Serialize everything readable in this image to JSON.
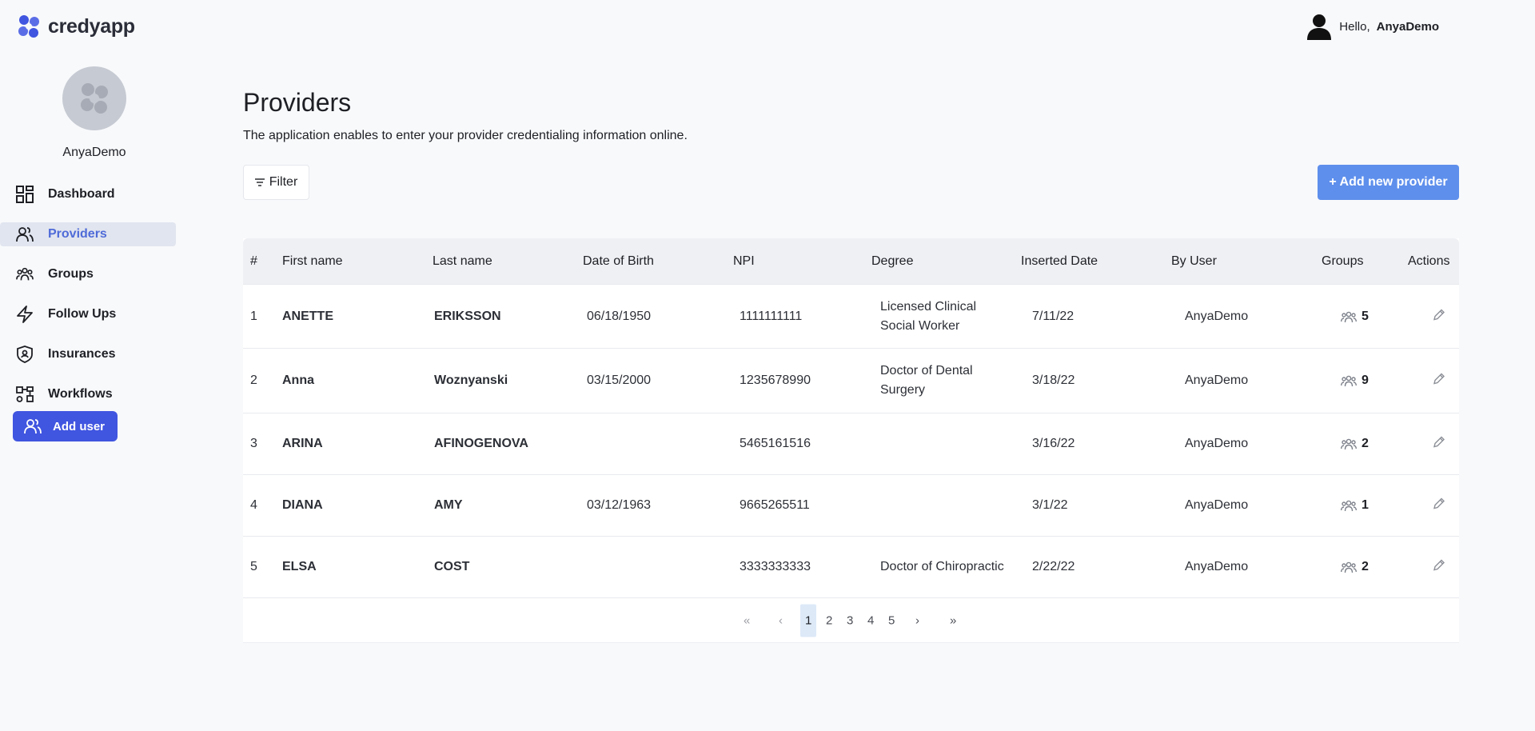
{
  "brand": {
    "name": "credyapp",
    "accent": "#4055e0"
  },
  "header": {
    "greeting": "Hello,",
    "user_name": "AnyaDemo",
    "user_icon": "user-silhouette-icon"
  },
  "sidebar": {
    "account_name": "AnyaDemo",
    "items": [
      {
        "label": "Dashboard",
        "icon": "dashboard-icon"
      },
      {
        "label": "Providers",
        "icon": "users-icon",
        "active": true
      },
      {
        "label": "Groups",
        "icon": "groups-icon"
      },
      {
        "label": "Follow Ups",
        "icon": "lightning-icon"
      },
      {
        "label": "Insurances",
        "icon": "shield-icon"
      },
      {
        "label": "Workflows",
        "icon": "workflow-icon"
      }
    ],
    "add_user_label": "Add user"
  },
  "main": {
    "title": "Providers",
    "subtitle": "The application enables to enter your provider credentialing information online.",
    "filter_label": "Filter",
    "add_provider_label": "+ Add new provider"
  },
  "table": {
    "columns": [
      "#",
      "First name",
      "Last name",
      "Date of Birth",
      "NPI",
      "Degree",
      "Inserted Date",
      "By User",
      "Groups",
      "Actions"
    ],
    "rows": [
      {
        "num": "1",
        "first": "ANETTE",
        "last": "ERIKSSON",
        "dob": "06/18/1950",
        "npi": "1111111111",
        "degree": "Licensed Clinical Social Worker",
        "inserted": "7/11/22",
        "by": "AnyaDemo",
        "groups": "5"
      },
      {
        "num": "2",
        "first": "Anna",
        "last": "Woznyanski",
        "dob": "03/15/2000",
        "npi": "1235678990",
        "degree": "Doctor of Dental Surgery",
        "inserted": "3/18/22",
        "by": "AnyaDemo",
        "groups": "9"
      },
      {
        "num": "3",
        "first": "ARINA",
        "last": "AFINOGENOVA",
        "dob": "",
        "npi": "5465161516",
        "degree": "",
        "inserted": "3/16/22",
        "by": "AnyaDemo",
        "groups": "2"
      },
      {
        "num": "4",
        "first": "DIANA",
        "last": "AMY",
        "dob": "03/12/1963",
        "npi": "9665265511",
        "degree": "",
        "inserted": "3/1/22",
        "by": "AnyaDemo",
        "groups": "1"
      },
      {
        "num": "5",
        "first": "ELSA",
        "last": "COST",
        "dob": "",
        "npi": "3333333333",
        "degree": "Doctor of Chiropractic",
        "inserted": "2/22/22",
        "by": "AnyaDemo",
        "groups": "2"
      }
    ]
  },
  "pagination": {
    "first": "«",
    "prev": "‹",
    "pages": [
      "1",
      "2",
      "3",
      "4",
      "5"
    ],
    "current": "1",
    "next": "›",
    "last": "»"
  }
}
